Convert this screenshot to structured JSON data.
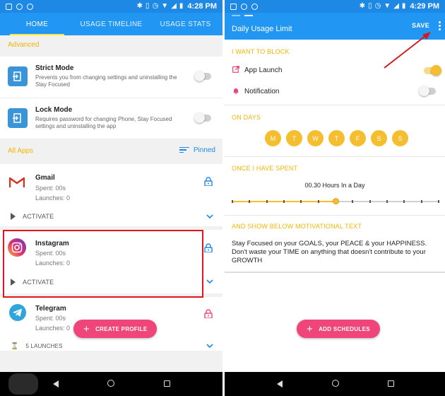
{
  "status_left": {
    "time": "4:28 PM"
  },
  "status_right": {
    "time": "4:29 PM"
  },
  "left": {
    "tabs": [
      {
        "label": "HOME",
        "active": true
      },
      {
        "label": "USAGE TIMELINE",
        "active": false
      },
      {
        "label": "USAGE STATS",
        "active": false
      }
    ],
    "advanced_label": "Advanced",
    "settings": [
      {
        "title": "Strict Mode",
        "desc": "Prevents you from changing settings and uninstalling the Stay Focused",
        "enabled": false
      },
      {
        "title": "Lock Mode",
        "desc": "Requires password for changing Phone, Stay Focused settings and uninstalling the app",
        "enabled": false
      }
    ],
    "all_apps_label": "All Apps",
    "pinned_label": "Pinned",
    "apps": [
      {
        "name": "Gmail",
        "spent": "Spent: 00s",
        "launches": "Launches: 0",
        "activate": "ACTIVATE",
        "lock_color": "#1e88e5"
      },
      {
        "name": "Instagram",
        "spent": "Spent: 00s",
        "launches": "Launches: 0",
        "activate": "ACTIVATE",
        "lock_color": "#1e88e5"
      },
      {
        "name": "Telegram",
        "spent": "Spent: 00s",
        "launches": "Launches: 0",
        "activate": "5 LAUNCHES",
        "lock_color": "#f0457a"
      }
    ],
    "fab_label": "CREATE PROFILE"
  },
  "right": {
    "title": "Daily Usage Limit",
    "save_label": "SAVE",
    "block_section": "I WANT TO BLOCK",
    "block_items": [
      {
        "label": "App Launch",
        "enabled": true
      },
      {
        "label": "Notification",
        "enabled": false
      }
    ],
    "days_section": "ON DAYS",
    "days": [
      "M",
      "T",
      "W",
      "T",
      "F",
      "S",
      "S"
    ],
    "spent_section": "ONCE I HAVE SPENT",
    "hours_text": "00.30 Hours In a Day",
    "slider_value_fraction": 0.5,
    "motivation_section": "AND SHOW BELOW MOTIVATIONAL TEXT",
    "motivation_text": "Stay Focused on your GOALS, your PEACE & your HAPPINESS. Don't waste your TIME on anything that doesn't contribute to your GROWTH",
    "fab_label": "ADD SCHEDULES"
  },
  "colors": {
    "primary": "#2196f3",
    "accent": "#f5be2f",
    "fab": "#f0457a",
    "highlight": "#e0161b"
  }
}
